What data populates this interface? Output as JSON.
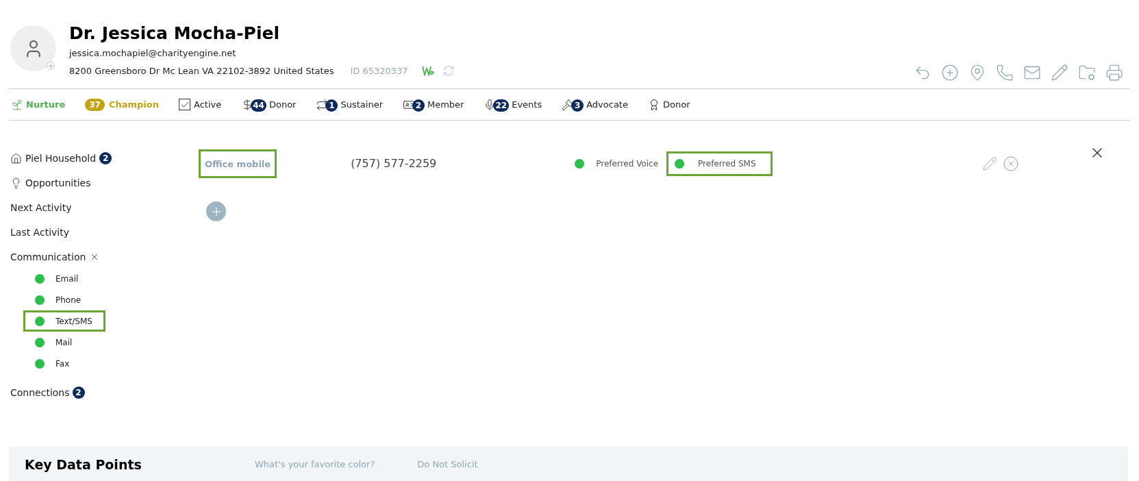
{
  "contact": {
    "name": "Dr. Jessica Mocha-Piel",
    "email": "jessica.mochapiel@charityengine.net",
    "address": "8200 Greensboro Dr Mc Lean VA 22102-3892 United States",
    "id": "ID 65320337"
  },
  "badges": [
    {
      "kind": "status",
      "label": "Nurture",
      "color": "#4caf50"
    },
    {
      "kind": "pill",
      "count": "37",
      "label": "Champion",
      "color": "#c5a116"
    },
    {
      "kind": "checkbox",
      "label": "Active",
      "checked": true
    },
    {
      "kind": "counted",
      "count": "44",
      "label": "Donor"
    },
    {
      "kind": "counted",
      "count": "1",
      "label": "Sustainer"
    },
    {
      "kind": "counted",
      "count": "2",
      "label": "Member"
    },
    {
      "kind": "counted",
      "count": "22",
      "label": "Events"
    },
    {
      "kind": "counted",
      "count": "3",
      "label": "Advocate"
    },
    {
      "kind": "plain",
      "label": "Donor",
      "color": "#222222"
    }
  ],
  "sidebar": {
    "household": {
      "label": "Piel Household",
      "count": "2"
    },
    "opportunities": "Opportunities",
    "next_activity": "Next Activity",
    "last_activity": "Last Activity",
    "communication": {
      "label": "Communication",
      "expanded": true,
      "channels": [
        {
          "label": "Email",
          "on": true,
          "highlighted": false
        },
        {
          "label": "Phone",
          "on": true,
          "highlighted": false
        },
        {
          "label": "Text/SMS",
          "on": true,
          "highlighted": true
        },
        {
          "label": "Mail",
          "on": true,
          "highlighted": false
        },
        {
          "label": "Fax",
          "on": true,
          "highlighted": false
        }
      ]
    },
    "connections": {
      "label": "Connections",
      "count": "2"
    }
  },
  "phone": {
    "type": {
      "label": "Office mobile",
      "highlighted": true
    },
    "number": "(757) 577-2259",
    "preferences": [
      {
        "label": "Preferred Voice",
        "on": true,
        "highlighted": false
      },
      {
        "label": "Preferred SMS",
        "on": true,
        "highlighted": true
      }
    ]
  },
  "key_data": {
    "title": "Key Data Points",
    "fields": [
      "What's your favorite color?",
      "Do Not Solicit"
    ]
  }
}
